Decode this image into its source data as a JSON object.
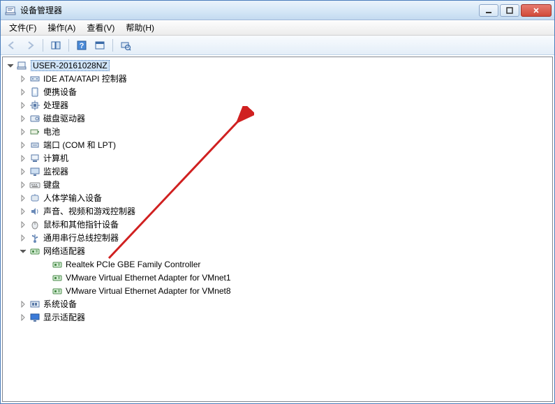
{
  "window": {
    "title": "设备管理器"
  },
  "menu": {
    "file": "文件(F)",
    "action": "操作(A)",
    "view": "查看(V)",
    "help": "帮助(H)"
  },
  "tree": {
    "root": {
      "label": "USER-20161028NZ",
      "expanded": true
    },
    "categories": [
      {
        "key": "ide",
        "label": "IDE ATA/ATAPI 控制器",
        "expanded": false,
        "icon": "ide"
      },
      {
        "key": "portable",
        "label": "便携设备",
        "expanded": false,
        "icon": "portable"
      },
      {
        "key": "cpu",
        "label": "处理器",
        "expanded": false,
        "icon": "cpu"
      },
      {
        "key": "disk",
        "label": "磁盘驱动器",
        "expanded": false,
        "icon": "disk"
      },
      {
        "key": "battery",
        "label": "电池",
        "expanded": false,
        "icon": "battery"
      },
      {
        "key": "ports",
        "label": "端口 (COM 和 LPT)",
        "expanded": false,
        "icon": "ports"
      },
      {
        "key": "computer",
        "label": "计算机",
        "expanded": false,
        "icon": "computer"
      },
      {
        "key": "monitor",
        "label": "监视器",
        "expanded": false,
        "icon": "monitor"
      },
      {
        "key": "keyboard",
        "label": "键盘",
        "expanded": false,
        "icon": "keyboard"
      },
      {
        "key": "hid",
        "label": "人体学输入设备",
        "expanded": false,
        "icon": "hid"
      },
      {
        "key": "sound",
        "label": "声音、视频和游戏控制器",
        "expanded": false,
        "icon": "sound"
      },
      {
        "key": "mouse",
        "label": "鼠标和其他指针设备",
        "expanded": false,
        "icon": "mouse"
      },
      {
        "key": "usb",
        "label": "通用串行总线控制器",
        "expanded": false,
        "icon": "usb"
      },
      {
        "key": "network",
        "label": "网络适配器",
        "expanded": true,
        "icon": "network",
        "children": [
          {
            "label": "Realtek PCIe GBE Family Controller"
          },
          {
            "label": "VMware Virtual Ethernet Adapter for VMnet1"
          },
          {
            "label": "VMware Virtual Ethernet Adapter for VMnet8"
          }
        ]
      },
      {
        "key": "system",
        "label": "系统设备",
        "expanded": false,
        "icon": "system"
      },
      {
        "key": "display",
        "label": "显示适配器",
        "expanded": false,
        "icon": "display"
      }
    ]
  }
}
